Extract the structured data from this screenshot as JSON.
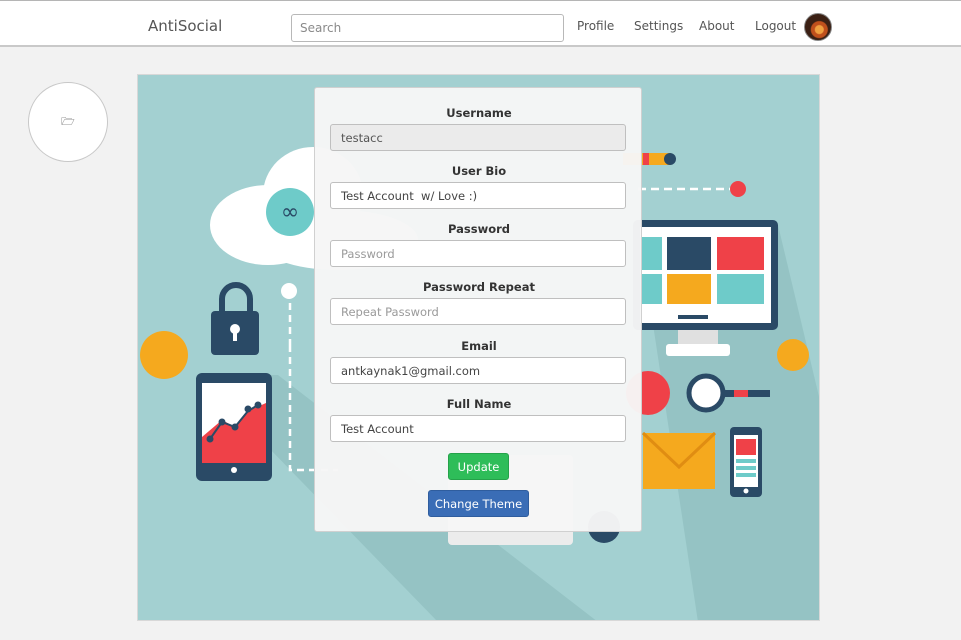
{
  "navbar": {
    "brand": "AntiSocial",
    "search_placeholder": "Search",
    "links": {
      "profile": "Profile",
      "settings": "Settings",
      "about": "About",
      "logout": "Logout"
    }
  },
  "upload": {
    "icon_glyph": "🗁"
  },
  "form": {
    "username_label": "Username",
    "username_value": "testacc",
    "bio_label": "User Bio",
    "bio_value": "Test Account  w/ Love :)",
    "password_label": "Password",
    "password_placeholder": "Password",
    "password_repeat_label": "Password Repeat",
    "password_repeat_placeholder": "Repeat Password",
    "email_label": "Email",
    "email_value": "antkaynak1@gmail.com",
    "fullname_label": "Full Name",
    "fullname_value": "Test Account",
    "update_button": "Update",
    "theme_button": "Change Theme"
  },
  "colors": {
    "hero_bg": "#a3d0d1",
    "update_green": "#2ebd59",
    "theme_blue": "#3a6db6"
  }
}
